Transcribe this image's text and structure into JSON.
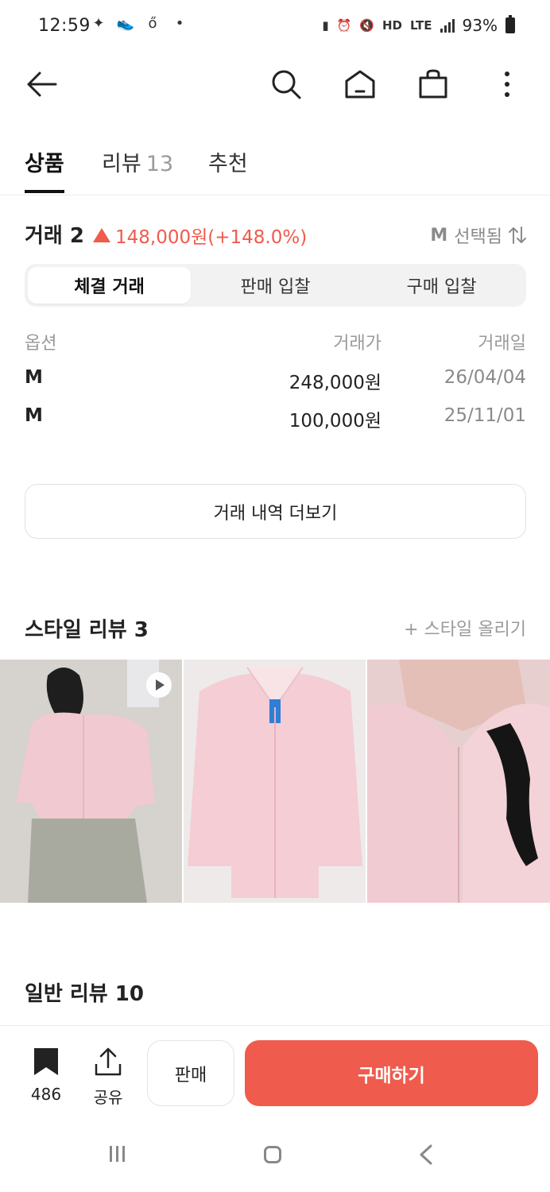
{
  "status_bar": {
    "time": "12:59",
    "battery": "93%",
    "network_hd": "HD",
    "network_lte": "LTE"
  },
  "tabs": {
    "product": "상품",
    "review": "리뷰",
    "review_count": "13",
    "recommend": "추천"
  },
  "trade": {
    "title": "거래 2",
    "change": "148,000원(+148.0%)",
    "selected_size": "M",
    "selected_label": "선택됨",
    "segments": [
      "체결 거래",
      "판매 입찰",
      "구매 입찰"
    ],
    "columns": [
      "옵션",
      "거래가",
      "거래일"
    ],
    "rows": [
      {
        "option": "M",
        "price": "248,000원",
        "date": "26/04/04"
      },
      {
        "option": "M",
        "price": "100,000원",
        "date": "25/11/01"
      }
    ],
    "more_button": "거래 내역 더보기"
  },
  "style_review": {
    "title": "스타일 리뷰 3",
    "upload": "+ 스타일 올리기"
  },
  "general_review": {
    "title": "일반 리뷰 10"
  },
  "bottom_bar": {
    "bookmark_count": "486",
    "share_label": "공유",
    "sell_label": "판매",
    "buy_label": "구매하기"
  },
  "colors": {
    "accent": "#ef5b4c"
  }
}
